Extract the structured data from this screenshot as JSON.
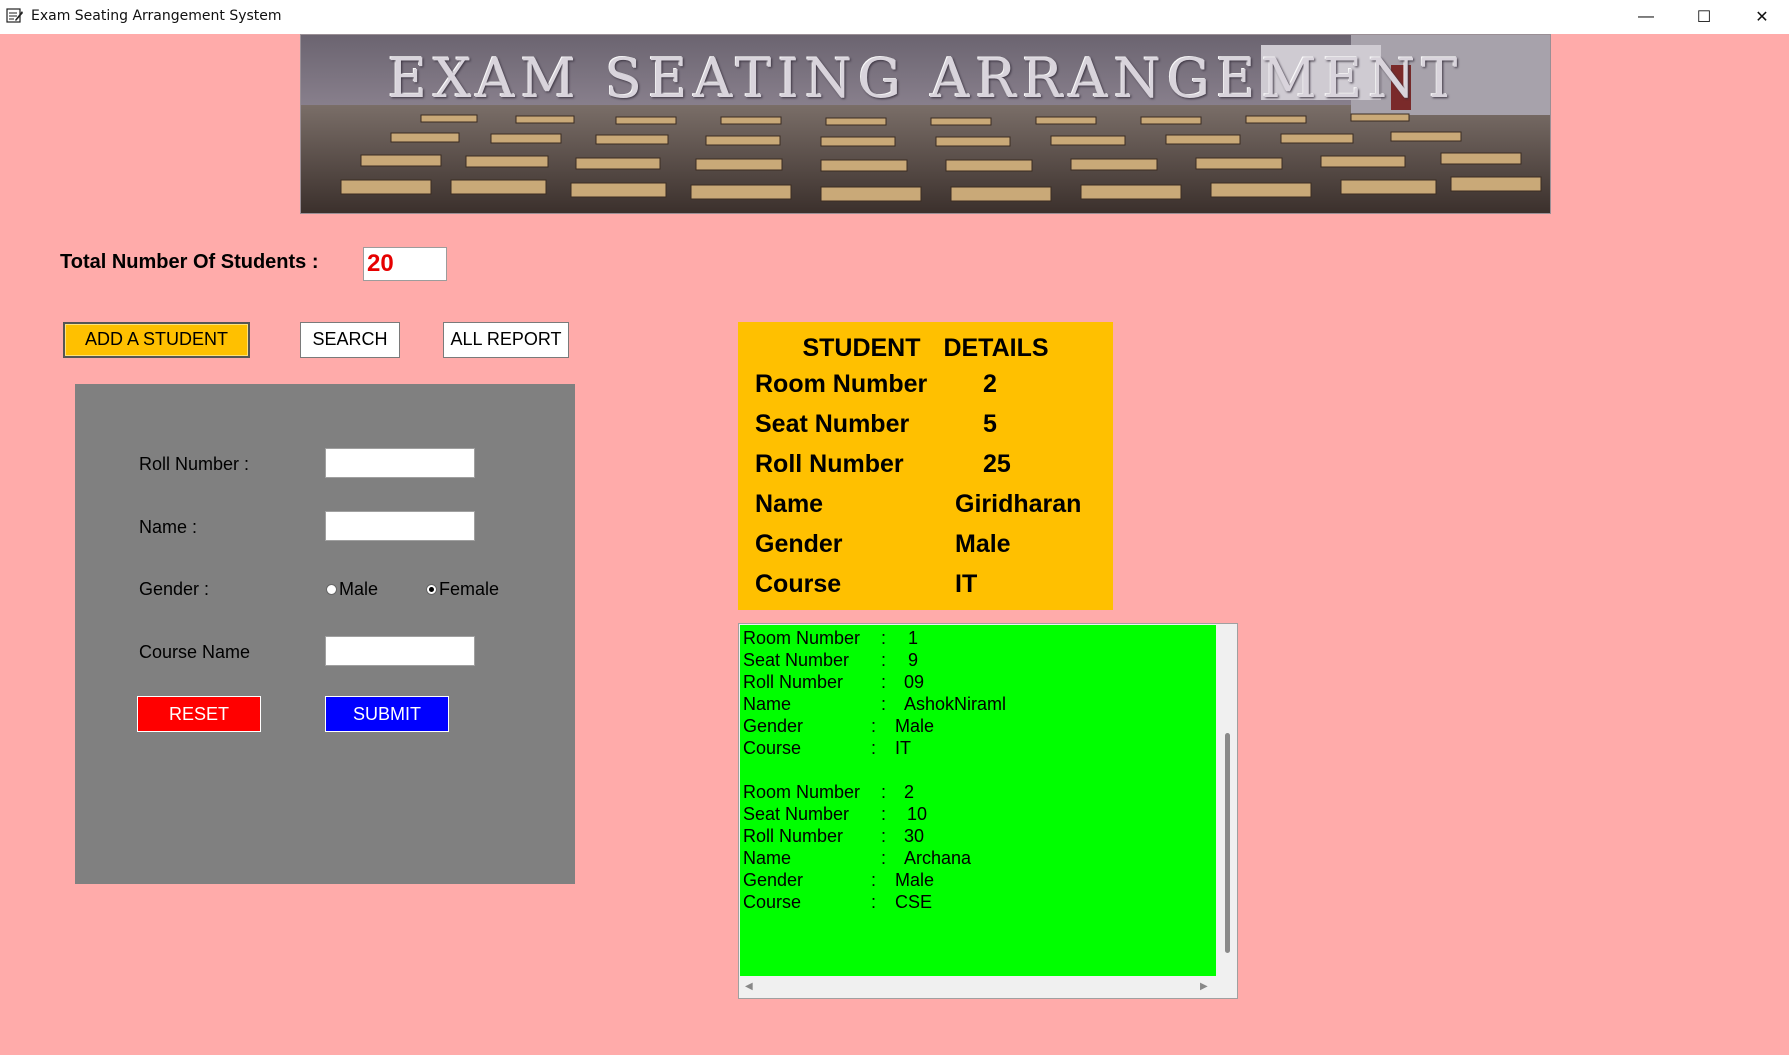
{
  "window": {
    "title": "Exam Seating Arrangement System",
    "minimize_glyph": "—",
    "maximize_glyph": "☐",
    "close_glyph": "✕"
  },
  "banner": {
    "title": "EXAM SEATING ARRANGEMENT"
  },
  "total": {
    "label": "Total Number Of Students :",
    "value": "20"
  },
  "toolbar": {
    "add_label": "ADD A STUDENT",
    "search_label": "SEARCH",
    "report_label": "ALL REPORT"
  },
  "form": {
    "roll_label": "Roll Number :",
    "name_label": "Name :",
    "gender_label": "Gender :",
    "male_label": "Male",
    "female_label": "Female",
    "gender_selected": "Female",
    "course_label": "Course Name",
    "reset_label": "RESET",
    "submit_label": "SUBMIT"
  },
  "details": {
    "title": "STUDENT DETAILS",
    "rows": [
      {
        "label": "Room Number",
        "value": "2"
      },
      {
        "label": "Seat Number",
        "value": "5"
      },
      {
        "label": "Roll Number",
        "value": "25"
      },
      {
        "label": "Name",
        "value": "Giridharan"
      },
      {
        "label": "Gender",
        "value": "Male"
      },
      {
        "label": "Course",
        "value": "IT"
      }
    ]
  },
  "report": {
    "records": [
      [
        {
          "key": "Room Number",
          "value": "1"
        },
        {
          "key": "Seat Number",
          "value": "9"
        },
        {
          "key": "Roll Number",
          "value": "09"
        },
        {
          "key": "Name",
          "value": "AshokNiraml"
        },
        {
          "key": "Gender",
          "value": "Male"
        },
        {
          "key": "Course",
          "value": "IT"
        }
      ],
      [
        {
          "key": "Room Number",
          "value": "2"
        },
        {
          "key": "Seat Number",
          "value": "10"
        },
        {
          "key": "Roll Number",
          "value": "30"
        },
        {
          "key": "Name",
          "value": "Archana"
        },
        {
          "key": "Gender",
          "value": "Male"
        },
        {
          "key": "Course",
          "value": "CSE"
        }
      ]
    ],
    "separator": ":"
  },
  "colors": {
    "background": "#ffabaa",
    "add_button": "#ffc000",
    "details_panel": "#ffc000",
    "report_panel": "#00ff00",
    "reset_button": "#ff0000",
    "submit_button": "#0000ff",
    "form_panel": "#808080",
    "total_value_text": "#e60000"
  }
}
